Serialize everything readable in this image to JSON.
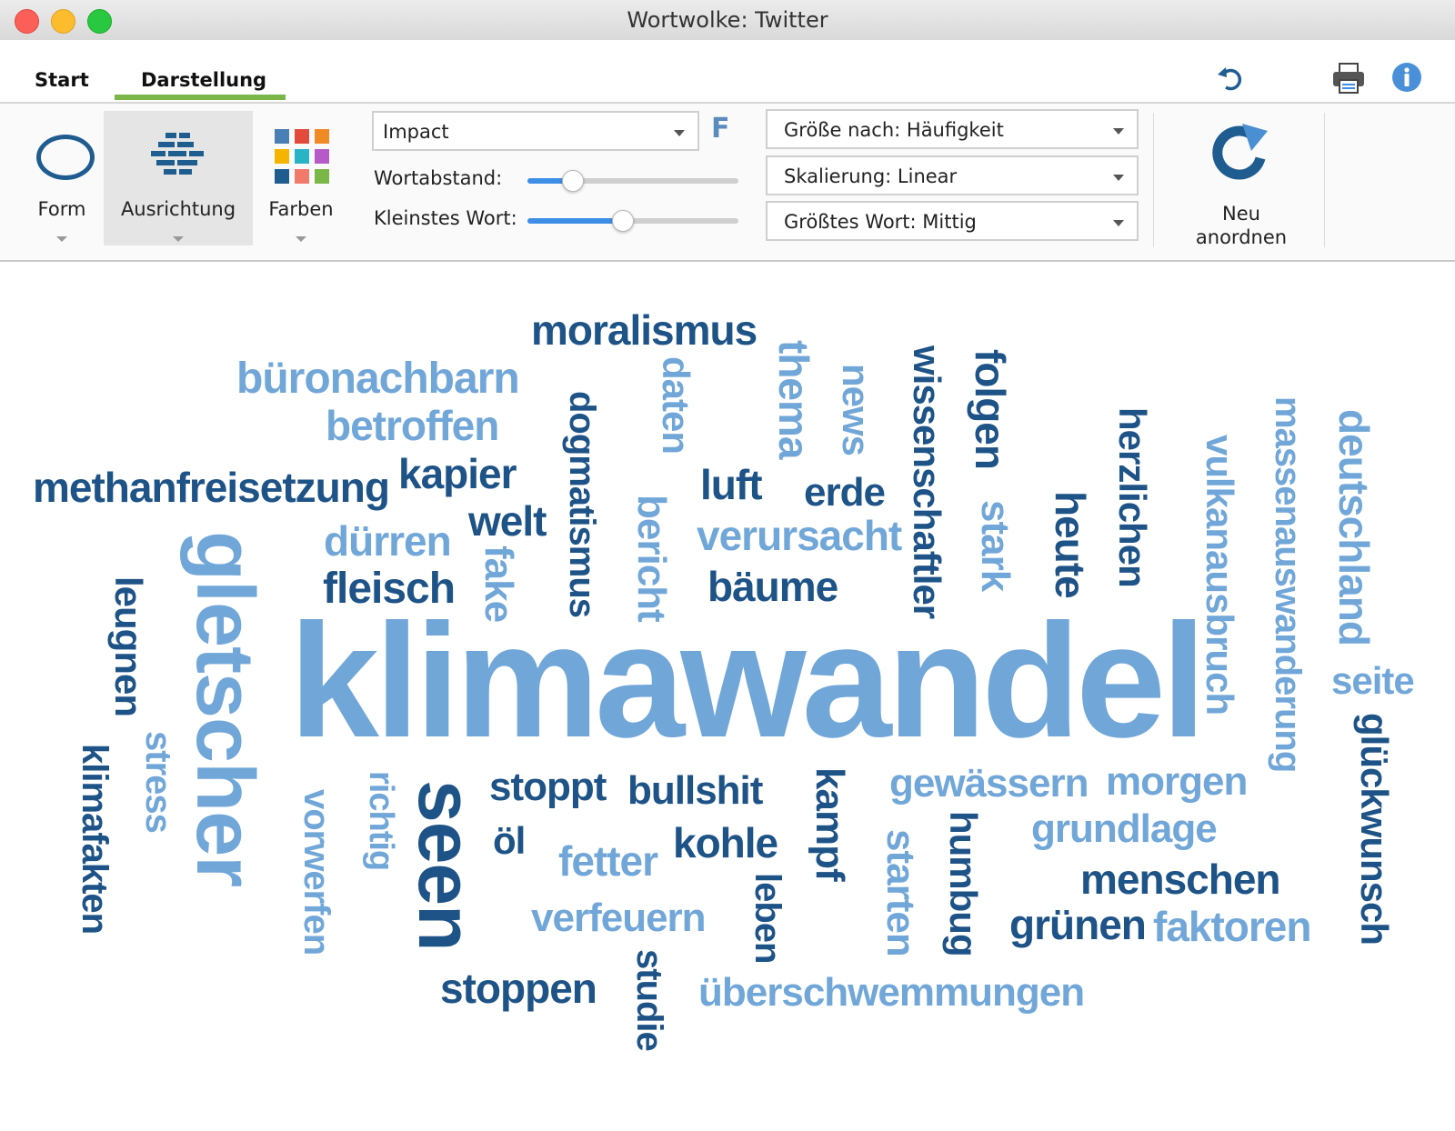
{
  "window": {
    "title": "Wortwolke: Twitter"
  },
  "tabs": [
    {
      "label": "Start"
    },
    {
      "label": "Darstellung"
    }
  ],
  "icons": {
    "undo": "undo-icon",
    "print": "printer-icon",
    "info": "info-icon"
  },
  "ribbon": {
    "form_label": "Form",
    "ausrichtung_label": "Ausrichtung",
    "farben_label": "Farben",
    "font": "Impact",
    "font_badge": "F",
    "wortabstand_label": "Wortabstand:",
    "wortabstand_value": 0.21,
    "kleinstes_wort_label": "Kleinstes Wort:",
    "kleinstes_wort_value": 0.45,
    "groesse": "Größe nach: Häufigkeit",
    "skalierung": "Skalierung: Linear",
    "groesstes_wort": "Größtes Wort: Mittig",
    "neu_label_1": "Neu",
    "neu_label_2": "anordnen"
  },
  "colors": {
    "dark_word": "#1e5387",
    "light_word": "#71a7d8",
    "tab_accent": "#7ab648",
    "palette": [
      "#4a7fb5",
      "#e24a3b",
      "#f08a24",
      "#f5b400",
      "#29b3c7",
      "#b65ac9",
      "#1f5c90",
      "#f27a6a",
      "#7ab648"
    ]
  },
  "words": [
    "klimawandel",
    "gletscher",
    "seen",
    "moralismus",
    "büronachbarn",
    "betroffen",
    "methanfreisetzung",
    "kapier",
    "welt",
    "dürren",
    "fleisch",
    "fake",
    "dogmatismus",
    "daten",
    "bericht",
    "thema",
    "news",
    "luft",
    "erde",
    "verursacht",
    "bäume",
    "wissenschaftler",
    "folgen",
    "stark",
    "heute",
    "herzlichen",
    "vulkanausbruch",
    "massenauswanderung",
    "deutschland",
    "seite",
    "glückwunsch",
    "leugnen",
    "stress",
    "klimafakten",
    "vorwerfen",
    "richtig",
    "stoppt",
    "bullshit",
    "öl",
    "fetter",
    "kohle",
    "kampf",
    "leben",
    "gewässern",
    "morgen",
    "grundlage",
    "menschen",
    "grünen",
    "faktoren",
    "starten",
    "humbug",
    "verfeuern",
    "stoppen",
    "studie",
    "überschwemmungen"
  ]
}
